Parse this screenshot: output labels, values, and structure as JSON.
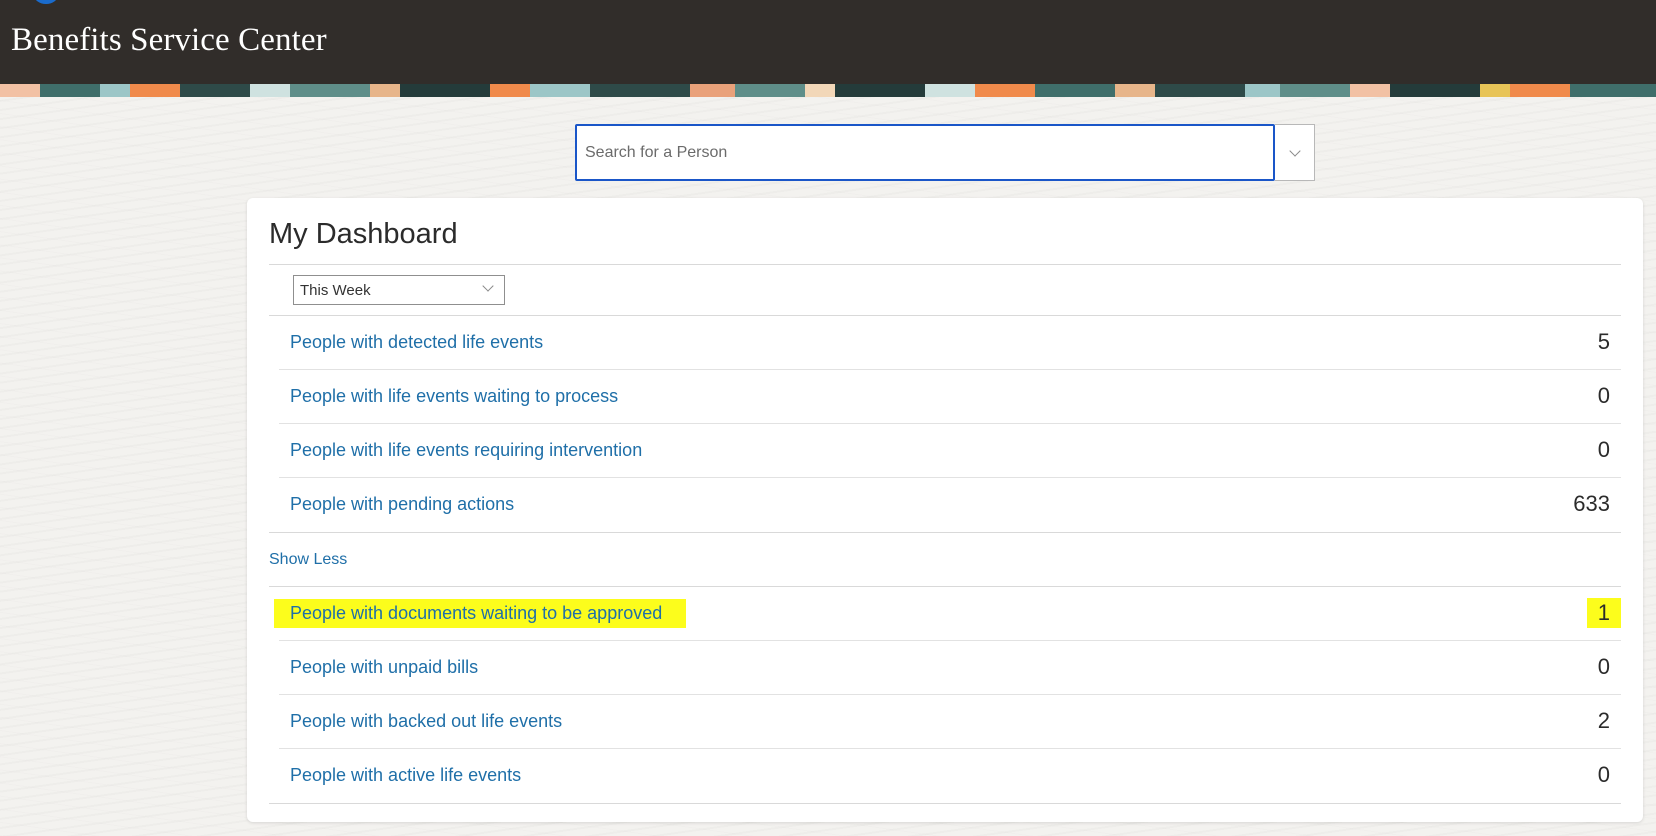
{
  "header": {
    "title": "Benefits Service Center"
  },
  "search": {
    "placeholder": "Search for a Person",
    "dropdown_icon": "chevron-down-icon"
  },
  "dashboard": {
    "title": "My Dashboard",
    "period": "This Week",
    "primary_rows": [
      {
        "label": "People with detected life events",
        "count": "5"
      },
      {
        "label": "People with life events waiting to process",
        "count": "0"
      },
      {
        "label": "People with life events requiring intervention",
        "count": "0"
      },
      {
        "label": "People with pending actions",
        "count": "633"
      }
    ],
    "toggle_label": "Show Less",
    "extra_rows": [
      {
        "label": "People with documents waiting to be approved",
        "count": "1"
      },
      {
        "label": "People with unpaid bills",
        "count": "0"
      },
      {
        "label": "People with backed out life events",
        "count": "2"
      },
      {
        "label": "People with active life events",
        "count": "0"
      }
    ]
  },
  "colors": {
    "header_bg": "#312d2a",
    "link": "#1f6fa8",
    "highlight": "#fcfd1c",
    "search_focus": "#1a56c8"
  }
}
